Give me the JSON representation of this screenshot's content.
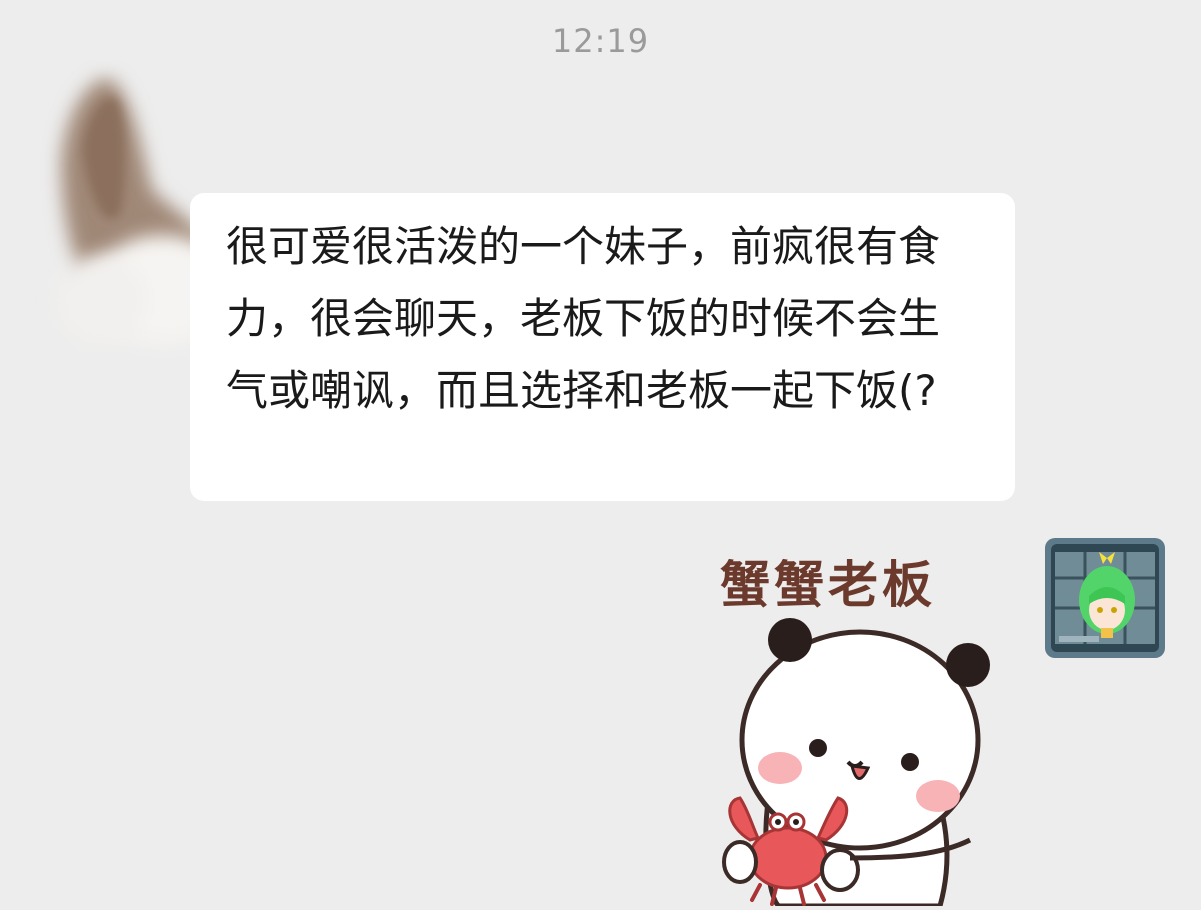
{
  "chat": {
    "timestamp": "12:19",
    "messages": [
      {
        "side": "left",
        "type": "text",
        "text": "很可爱很活泼的一个妹子，前疯很有食力，很会聊天，老板下饭的时候不会生气或嘲讽，而且选择和老板一起下饭(?"
      },
      {
        "side": "right",
        "type": "sticker",
        "caption": "蟹蟹老板",
        "icon": "panda-holding-crab-sticker"
      }
    ]
  },
  "colors": {
    "background": "#ededed",
    "bubble_left": "#ffffff",
    "timestamp_text": "#9a9a9a",
    "sticker_caption": "#6b3a2c",
    "crab": "#e8585a"
  }
}
